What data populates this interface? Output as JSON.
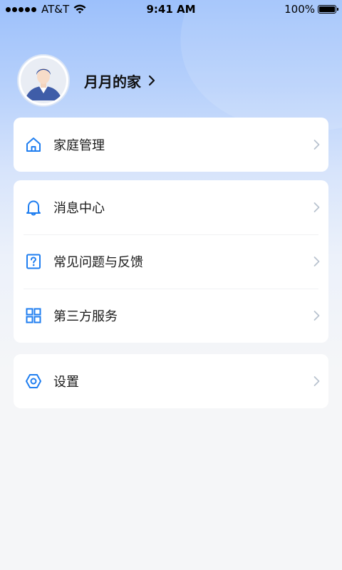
{
  "status_bar": {
    "carrier": "AT&T",
    "time": "9:41 AM",
    "battery": "100%"
  },
  "profile": {
    "name": "月月的家"
  },
  "menu": {
    "home_management": "家庭管理",
    "message_center": "消息中心",
    "faq_feedback": "常见问题与反馈",
    "third_party_services": "第三方服务",
    "settings": "设置"
  },
  "colors": {
    "accent": "#1f7ef0",
    "chevron": "#b8c2cf",
    "header_top": "#9cc0fb",
    "background": "#f5f6f8"
  },
  "icons": {
    "home": "home-icon",
    "bell": "bell-icon",
    "question": "question-icon",
    "grid": "grid-icon",
    "settings": "hexagon-settings-icon",
    "chevron": "chevron-right-icon"
  }
}
